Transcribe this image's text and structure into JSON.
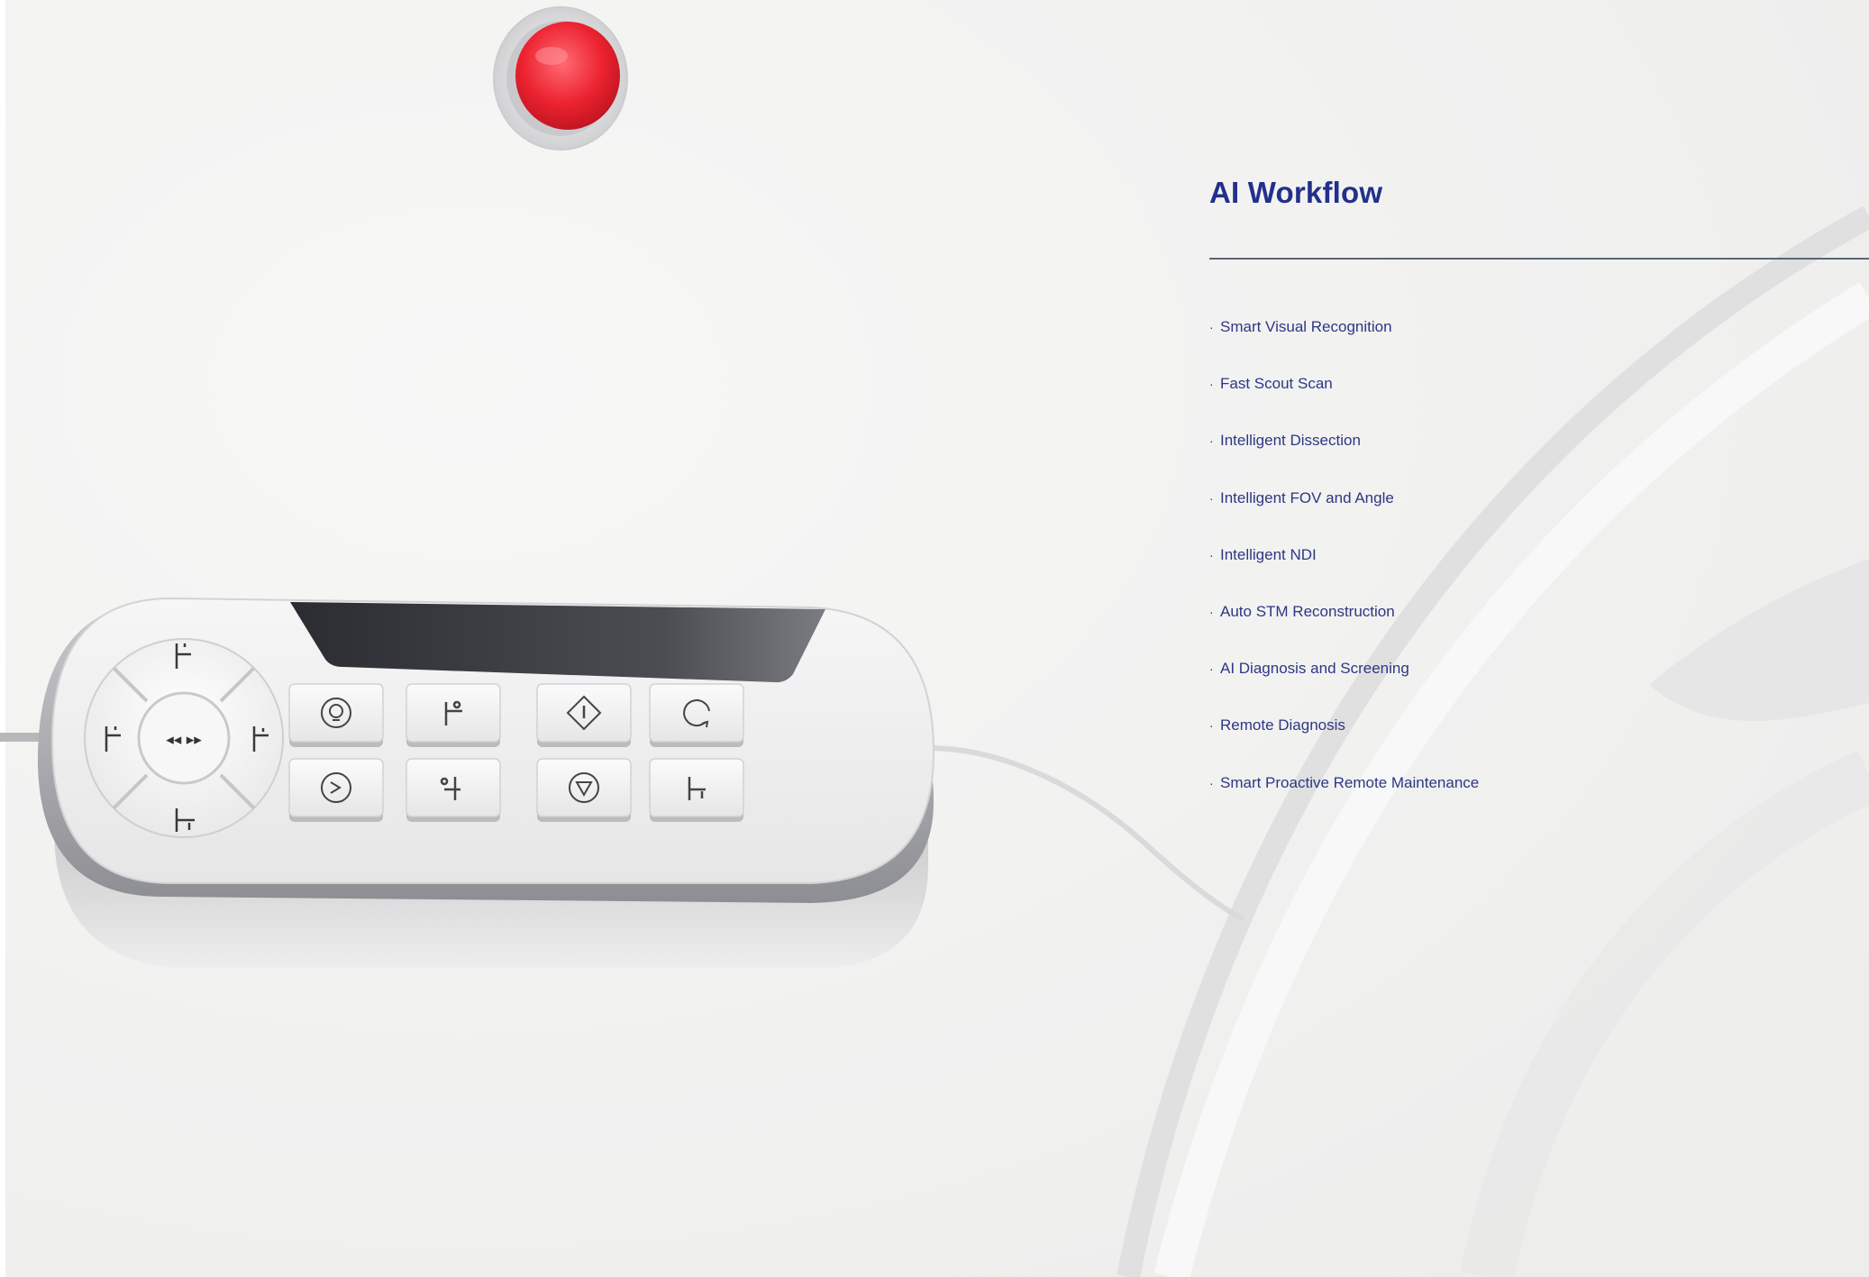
{
  "heading": "AI Workflow",
  "features": [
    "Smart Visual Recognition",
    "Fast Scout Scan",
    "Intelligent Dissection",
    "Intelligent FOV and Angle",
    "Intelligent NDI",
    "Auto STM Reconstruction",
    "AI Diagnosis and Screening",
    "Remote Diagnosis",
    "Smart Proactive Remote Maintenance"
  ],
  "bullet": "·",
  "controller": {
    "center_button_glyph": "◂◂ ▸▸",
    "keys": [
      "lamp-icon",
      "table-in-icon",
      "start-scan-icon",
      "rotate-icon",
      "voice-icon",
      "table-out-icon",
      "stop-icon",
      "table-down-icon"
    ]
  },
  "colors": {
    "heading": "#232f8c",
    "text": "#2e3783",
    "rule": "#5d6477",
    "emergency_button": "#e8212f",
    "background": "#f3f3f2"
  }
}
